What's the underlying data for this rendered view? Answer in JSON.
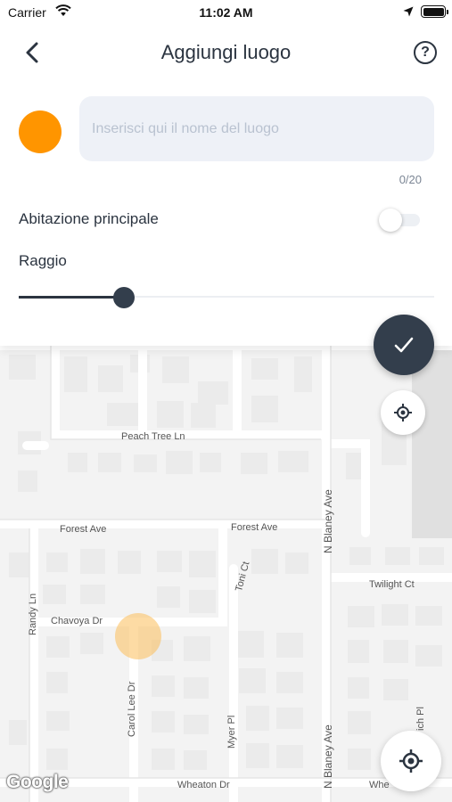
{
  "status_bar": {
    "carrier": "Carrier",
    "time": "11:02 AM"
  },
  "header": {
    "title": "Aggiungi luogo",
    "back_icon": "chevron-left-icon",
    "help_icon": "question-circle-icon",
    "help_glyph": "?"
  },
  "place_form": {
    "color": "#ff9500",
    "name_value": "",
    "name_placeholder": "Inserisci qui il nome del luogo",
    "char_counter": "0/20",
    "main_home_label": "Abitazione principale",
    "main_home_enabled": false,
    "radius_label": "Raggio",
    "radius_fraction": 0.25
  },
  "map": {
    "streets": [
      "Peach Tree Ln",
      "Forest Ave",
      "Forest Ave",
      "N Blaney Ave",
      "Toni Ct",
      "Twilight Ct",
      "Randy Ln",
      "Chavoya Dr",
      "Carol Lee Dr",
      "Myer Pl",
      "N Blaney Ave",
      "Wheaton Dr",
      "Whe",
      "ich Pl"
    ],
    "provider_logo": "Google"
  },
  "actions": {
    "confirm_icon": "checkmark-icon",
    "locate_icon": "crosshair-icon"
  },
  "colors": {
    "primary_dark": "#333e4c",
    "accent_orange": "#ff9500",
    "input_bg": "#eef1f7"
  }
}
